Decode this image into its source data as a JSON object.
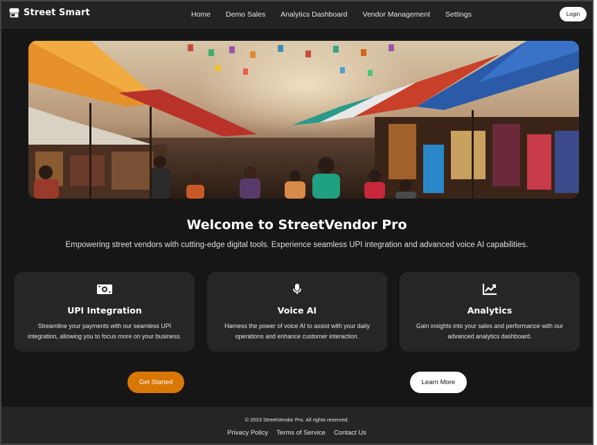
{
  "header": {
    "brand": "Street Smart",
    "brand_icon": "store-icon",
    "nav": [
      "Home",
      "Demo Sales",
      "Analytics Dashboard",
      "Vendor Management",
      "Settings"
    ],
    "login_label": "Login"
  },
  "hero": {
    "image_alt": "street-market-photo"
  },
  "welcome": {
    "title": "Welcome to StreetVendor Pro",
    "subtitle": "Empowering street vendors with cutting-edge digital tools. Experience seamless UPI integration and advanced voice AI capabilities."
  },
  "features": [
    {
      "icon": "money-icon",
      "title": "UPI Integration",
      "description": "Streamline your payments with our seamless UPI integration, allowing you to focus more on your business."
    },
    {
      "icon": "microphone-icon",
      "title": "Voice AI",
      "description": "Harness the power of voice AI to assist with your daily operations and enhance customer interaction."
    },
    {
      "icon": "chart-line-icon",
      "title": "Analytics",
      "description": "Gain insights into your sales and performance with our advanced analytics dashboard."
    }
  ],
  "actions": {
    "primary": "Get Started",
    "secondary": "Learn More"
  },
  "footer": {
    "copyright": "© 2023 StreetVendor Pro. All rights reserved.",
    "links": [
      "Privacy Policy",
      "Terms of Service",
      "Contact Us"
    ]
  },
  "colors": {
    "background": "#161616",
    "header": "#232323",
    "card": "#262626",
    "accent": "#d97706",
    "text": "#ffffff"
  }
}
